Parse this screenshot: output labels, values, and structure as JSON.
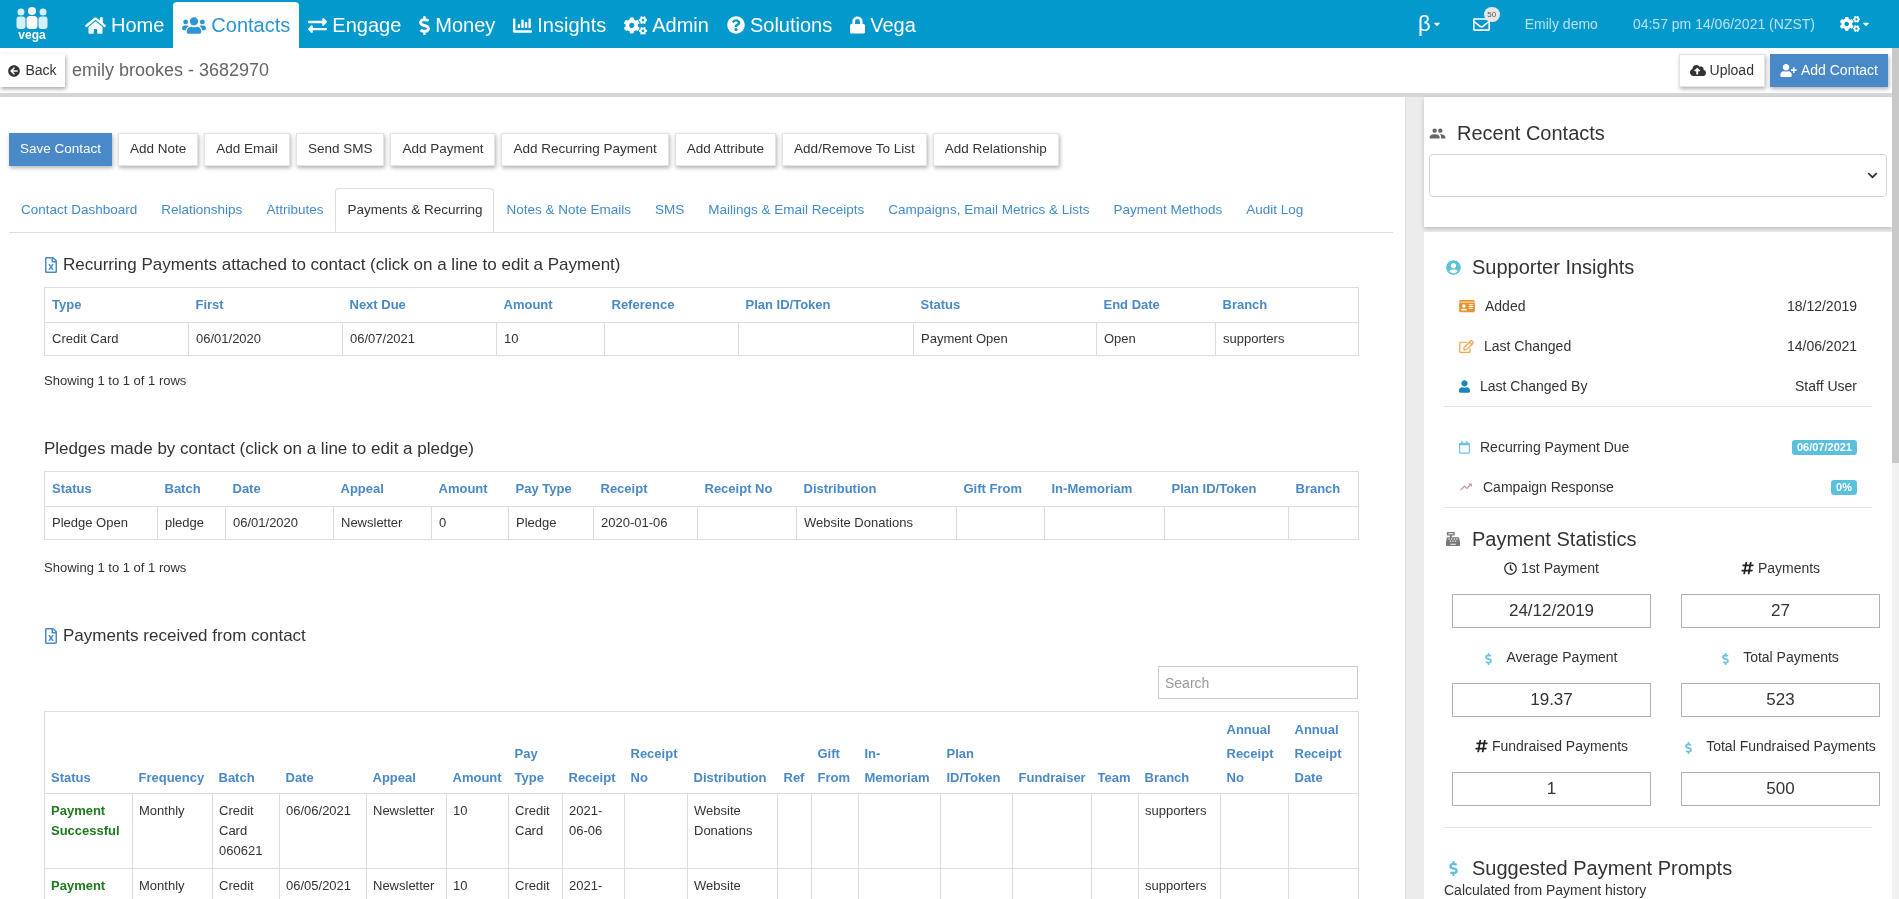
{
  "nav": {
    "logo_text": "vega",
    "items": [
      {
        "label": "Home",
        "selected": false
      },
      {
        "label": "Contacts",
        "selected": true
      },
      {
        "label": "Engage",
        "selected": false
      },
      {
        "label": "Money",
        "selected": false
      },
      {
        "label": "Insights",
        "selected": false
      },
      {
        "label": "Admin",
        "selected": false
      },
      {
        "label": "Solutions",
        "selected": false
      },
      {
        "label": "Vega",
        "selected": false
      }
    ],
    "beta": "β",
    "mail_count": "50",
    "user": "Emily demo",
    "datetime": "04:57 pm 14/06/2021 (NZST)"
  },
  "header": {
    "back": "Back",
    "title": "emily brookes - 3682970",
    "buttons": [
      {
        "label": "Upload",
        "kind": "default"
      },
      {
        "label": "Add Contact",
        "kind": "primary"
      }
    ]
  },
  "actions": [
    {
      "label": "Save Contact",
      "kind": "primary"
    },
    {
      "label": "Add Note",
      "kind": "default"
    },
    {
      "label": "Add Email",
      "kind": "default"
    },
    {
      "label": "Send SMS",
      "kind": "default"
    },
    {
      "label": "Add Payment",
      "kind": "default"
    },
    {
      "label": "Add Recurring Payment",
      "kind": "default"
    },
    {
      "label": "Add Attribute",
      "kind": "default"
    },
    {
      "label": "Add/Remove To List",
      "kind": "default"
    },
    {
      "label": "Add Relationship",
      "kind": "default"
    }
  ],
  "tabs": [
    {
      "label": "Contact Dashboard",
      "selected": false
    },
    {
      "label": "Relationships",
      "selected": false
    },
    {
      "label": "Attributes",
      "selected": false
    },
    {
      "label": "Payments & Recurring",
      "selected": true
    },
    {
      "label": "Notes & Note Emails",
      "selected": false
    },
    {
      "label": "SMS",
      "selected": false
    },
    {
      "label": "Mailings & Email Receipts",
      "selected": false
    },
    {
      "label": "Campaigns, Email Metrics & Lists",
      "selected": false
    },
    {
      "label": "Payment Methods",
      "selected": false
    },
    {
      "label": "Audit Log",
      "selected": false
    }
  ],
  "recurring": {
    "title": "Recurring Payments attached to contact (click on a line to edit a Payment)",
    "columns": [
      "Type",
      "First",
      "Next Due",
      "Amount",
      "Reference",
      "Plan ID/Token",
      "Status",
      "End Date",
      "Branch"
    ],
    "rows": [
      [
        "Credit Card",
        "06/01/2020",
        "06/07/2021",
        "10",
        null,
        null,
        "Payment Open",
        "Open",
        "supporters"
      ]
    ],
    "footer": "Showing 1 to 1 of 1 rows"
  },
  "pledges": {
    "title": "Pledges made by contact (click on a line to edit a pledge)",
    "columns": [
      "Status",
      "Batch",
      "Date",
      "Appeal",
      "Amount",
      "Pay Type",
      "Receipt",
      "Receipt No",
      "Distribution",
      "Gift From",
      "In-Memoriam",
      "Plan ID/Token",
      "Branch"
    ],
    "rows": [
      [
        "Pledge Open",
        "pledge",
        "06/01/2020",
        "Newsletter",
        "0",
        "Pledge",
        "2020-01-06",
        null,
        "Website Donations",
        null,
        null,
        null,
        null
      ]
    ],
    "footer": "Showing 1 to 1 of 1 rows"
  },
  "payments": {
    "title": "Payments received from contact",
    "search": {
      "placeholder": "Search"
    },
    "columns": [
      "Status",
      "Frequency",
      "Batch",
      "Date",
      "Appeal",
      "Amount",
      "Pay Type",
      "Receipt",
      "Receipt No",
      "Distribution",
      "Ref",
      "Gift From",
      "In-Memoriam",
      "Plan ID/Token",
      "Fundraiser",
      "Team",
      "Branch",
      "Annual Receipt No",
      "Annual Receipt Date"
    ],
    "rows": [
      [
        "Payment Successful",
        "Monthly",
        "Credit Card 060621",
        "06/06/2021",
        "Newsletter",
        "10",
        "Credit Card",
        "2021-06-06",
        null,
        "Website Donations",
        null,
        null,
        null,
        null,
        null,
        null,
        "supporters",
        null,
        null
      ],
      [
        "Payment",
        "Monthly",
        "Credit",
        "06/05/2021",
        "Newsletter",
        "10",
        "Credit",
        "2021-",
        null,
        "Website",
        null,
        null,
        null,
        null,
        null,
        null,
        "supporters",
        null,
        null
      ]
    ]
  },
  "recent_contacts": {
    "title": "Recent Contacts"
  },
  "supporter_insights": {
    "title": "Supporter Insights",
    "details": [
      {
        "label": "Added",
        "value": "18/12/2019"
      },
      {
        "label": "Last Changed",
        "value": "14/06/2021"
      },
      {
        "label": "Last Changed By",
        "value": "Staff User"
      }
    ],
    "indicators": [
      {
        "label": "Recurring Payment Due",
        "value": "06/07/2021"
      },
      {
        "label": "Campaign Response",
        "value": "0%"
      }
    ]
  },
  "payment_statistics": {
    "title": "Payment Statistics",
    "stats": [
      {
        "label": "1st Payment",
        "value": "24/12/2019"
      },
      {
        "label": "Payments",
        "value": "27"
      },
      {
        "label": "Average Payment",
        "value": "19.37"
      },
      {
        "label": "Total Payments",
        "value": "523"
      },
      {
        "label": "Fundraised Payments",
        "value": "1"
      },
      {
        "label": "Total Fundraised Payments",
        "value": "500"
      }
    ]
  },
  "suggested_prompts": {
    "title": "Suggested Payment Prompts",
    "note": "Calculated from Payment history"
  }
}
